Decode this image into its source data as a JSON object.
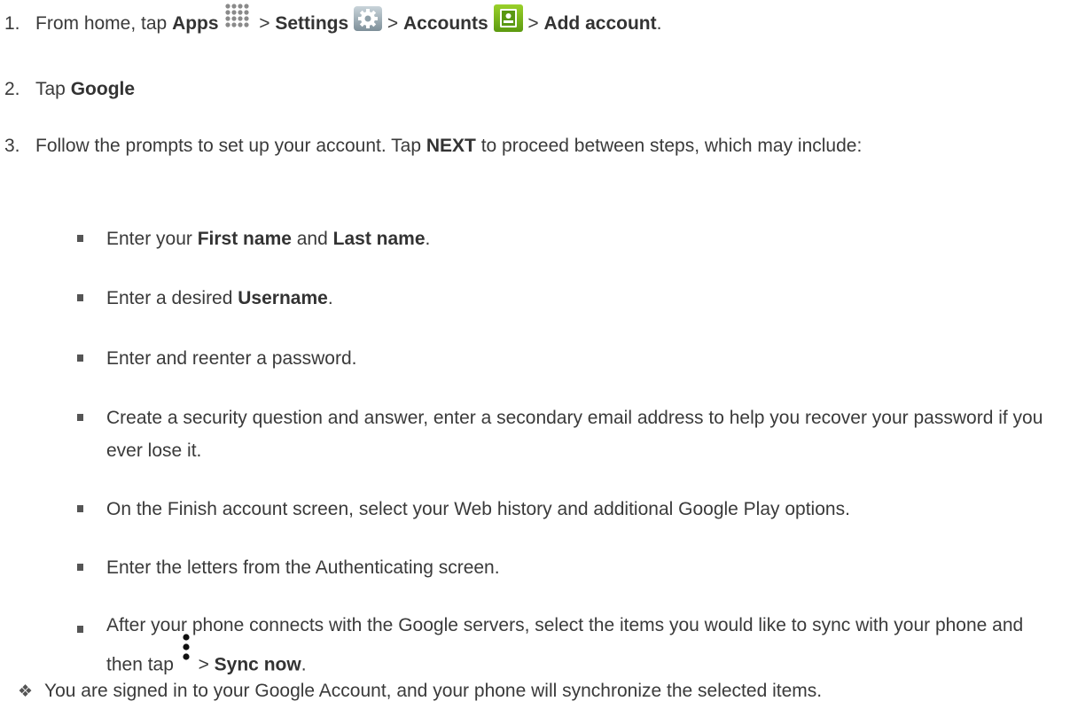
{
  "steps": [
    {
      "num": "1.",
      "t1": "From home, tap ",
      "b1": "Apps",
      "t2": " > ",
      "b2": "Settings",
      "t3": " > ",
      "b3": "Accounts",
      "t4": " > ",
      "b4": "Add account",
      "t5": ".",
      "icons": [
        "apps-grid-icon",
        "gear-icon",
        "contact-card-icon"
      ]
    },
    {
      "num": "2.",
      "t1": "Tap ",
      "b1": "Google"
    },
    {
      "num": "3.",
      "t1": "Follow the prompts to set up your account. Tap ",
      "b1": "NEXT",
      "t2": " to proceed between steps, which may include:"
    }
  ],
  "substeps": [
    {
      "t1": "Enter your ",
      "b1": "First name",
      "t2": " and ",
      "b2": "Last name",
      "t3": "."
    },
    {
      "t1": "Enter a desired ",
      "b1": "Username",
      "t2": "."
    },
    {
      "t1": "Enter and reenter a password."
    },
    {
      "t1": "Create a security question and answer, enter a secondary email address to help you recover your password if you ever lose it."
    },
    {
      "t1": "On the Finish account screen, select your Web history and additional Google Play options."
    },
    {
      "t1": "Enter the letters from the Authenticating screen."
    },
    {
      "t1": "After your phone connects with the Google servers, select the items you would like to sync with your phone and then tap ",
      "t2": " > ",
      "b1": "Sync now",
      "t3": ".",
      "icon": "menu-dots-icon"
    }
  ],
  "result": {
    "symbol": "❖",
    "text": "You are signed in to your Google Account, and your phone will synchronize the selected items."
  },
  "colors": {
    "text": "#3a3a3a",
    "green_icon": "#6db21c",
    "gear_icon": "#9aa9b1"
  }
}
